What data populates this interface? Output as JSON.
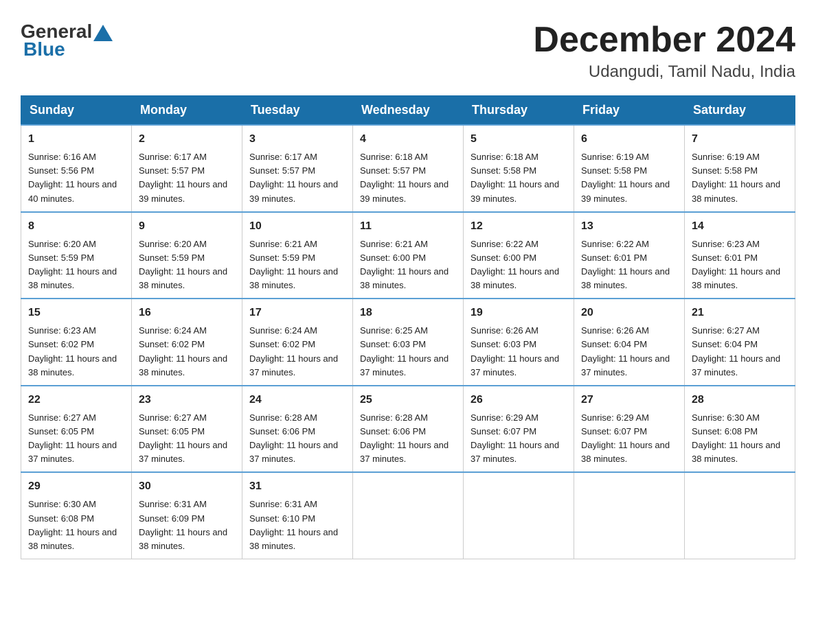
{
  "header": {
    "logo_general": "General",
    "logo_blue": "Blue",
    "month_title": "December 2024",
    "location": "Udangudi, Tamil Nadu, India"
  },
  "days_of_week": [
    "Sunday",
    "Monday",
    "Tuesday",
    "Wednesday",
    "Thursday",
    "Friday",
    "Saturday"
  ],
  "weeks": [
    [
      {
        "day": "1",
        "sunrise": "6:16 AM",
        "sunset": "5:56 PM",
        "daylight": "11 hours and 40 minutes."
      },
      {
        "day": "2",
        "sunrise": "6:17 AM",
        "sunset": "5:57 PM",
        "daylight": "11 hours and 39 minutes."
      },
      {
        "day": "3",
        "sunrise": "6:17 AM",
        "sunset": "5:57 PM",
        "daylight": "11 hours and 39 minutes."
      },
      {
        "day": "4",
        "sunrise": "6:18 AM",
        "sunset": "5:57 PM",
        "daylight": "11 hours and 39 minutes."
      },
      {
        "day": "5",
        "sunrise": "6:18 AM",
        "sunset": "5:58 PM",
        "daylight": "11 hours and 39 minutes."
      },
      {
        "day": "6",
        "sunrise": "6:19 AM",
        "sunset": "5:58 PM",
        "daylight": "11 hours and 39 minutes."
      },
      {
        "day": "7",
        "sunrise": "6:19 AM",
        "sunset": "5:58 PM",
        "daylight": "11 hours and 38 minutes."
      }
    ],
    [
      {
        "day": "8",
        "sunrise": "6:20 AM",
        "sunset": "5:59 PM",
        "daylight": "11 hours and 38 minutes."
      },
      {
        "day": "9",
        "sunrise": "6:20 AM",
        "sunset": "5:59 PM",
        "daylight": "11 hours and 38 minutes."
      },
      {
        "day": "10",
        "sunrise": "6:21 AM",
        "sunset": "5:59 PM",
        "daylight": "11 hours and 38 minutes."
      },
      {
        "day": "11",
        "sunrise": "6:21 AM",
        "sunset": "6:00 PM",
        "daylight": "11 hours and 38 minutes."
      },
      {
        "day": "12",
        "sunrise": "6:22 AM",
        "sunset": "6:00 PM",
        "daylight": "11 hours and 38 minutes."
      },
      {
        "day": "13",
        "sunrise": "6:22 AM",
        "sunset": "6:01 PM",
        "daylight": "11 hours and 38 minutes."
      },
      {
        "day": "14",
        "sunrise": "6:23 AM",
        "sunset": "6:01 PM",
        "daylight": "11 hours and 38 minutes."
      }
    ],
    [
      {
        "day": "15",
        "sunrise": "6:23 AM",
        "sunset": "6:02 PM",
        "daylight": "11 hours and 38 minutes."
      },
      {
        "day": "16",
        "sunrise": "6:24 AM",
        "sunset": "6:02 PM",
        "daylight": "11 hours and 38 minutes."
      },
      {
        "day": "17",
        "sunrise": "6:24 AM",
        "sunset": "6:02 PM",
        "daylight": "11 hours and 37 minutes."
      },
      {
        "day": "18",
        "sunrise": "6:25 AM",
        "sunset": "6:03 PM",
        "daylight": "11 hours and 37 minutes."
      },
      {
        "day": "19",
        "sunrise": "6:26 AM",
        "sunset": "6:03 PM",
        "daylight": "11 hours and 37 minutes."
      },
      {
        "day": "20",
        "sunrise": "6:26 AM",
        "sunset": "6:04 PM",
        "daylight": "11 hours and 37 minutes."
      },
      {
        "day": "21",
        "sunrise": "6:27 AM",
        "sunset": "6:04 PM",
        "daylight": "11 hours and 37 minutes."
      }
    ],
    [
      {
        "day": "22",
        "sunrise": "6:27 AM",
        "sunset": "6:05 PM",
        "daylight": "11 hours and 37 minutes."
      },
      {
        "day": "23",
        "sunrise": "6:27 AM",
        "sunset": "6:05 PM",
        "daylight": "11 hours and 37 minutes."
      },
      {
        "day": "24",
        "sunrise": "6:28 AM",
        "sunset": "6:06 PM",
        "daylight": "11 hours and 37 minutes."
      },
      {
        "day": "25",
        "sunrise": "6:28 AM",
        "sunset": "6:06 PM",
        "daylight": "11 hours and 37 minutes."
      },
      {
        "day": "26",
        "sunrise": "6:29 AM",
        "sunset": "6:07 PM",
        "daylight": "11 hours and 37 minutes."
      },
      {
        "day": "27",
        "sunrise": "6:29 AM",
        "sunset": "6:07 PM",
        "daylight": "11 hours and 38 minutes."
      },
      {
        "day": "28",
        "sunrise": "6:30 AM",
        "sunset": "6:08 PM",
        "daylight": "11 hours and 38 minutes."
      }
    ],
    [
      {
        "day": "29",
        "sunrise": "6:30 AM",
        "sunset": "6:08 PM",
        "daylight": "11 hours and 38 minutes."
      },
      {
        "day": "30",
        "sunrise": "6:31 AM",
        "sunset": "6:09 PM",
        "daylight": "11 hours and 38 minutes."
      },
      {
        "day": "31",
        "sunrise": "6:31 AM",
        "sunset": "6:10 PM",
        "daylight": "11 hours and 38 minutes."
      },
      null,
      null,
      null,
      null
    ]
  ],
  "labels": {
    "sunrise_prefix": "Sunrise: ",
    "sunset_prefix": "Sunset: ",
    "daylight_prefix": "Daylight: "
  }
}
